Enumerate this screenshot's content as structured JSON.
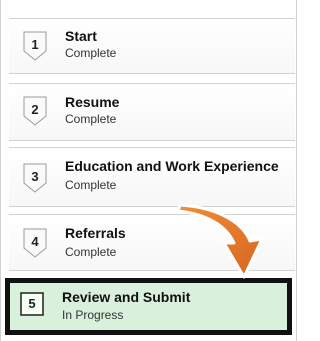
{
  "steps": [
    {
      "number": "1",
      "title": "Start",
      "status": "Complete"
    },
    {
      "number": "2",
      "title": "Resume",
      "status": "Complete"
    },
    {
      "number": "3",
      "title": "Education and Work Experience",
      "status": "Complete"
    },
    {
      "number": "4",
      "title": "Referrals",
      "status": "Complete"
    },
    {
      "number": "5",
      "title": "Review and Submit",
      "status": "In Progress"
    }
  ],
  "colors": {
    "active_background": "#d9f0dc",
    "active_border": "#111111",
    "arrow_fill": "#e8742a"
  },
  "icons": {
    "step_badge": "step-number-chevron-icon",
    "pointer": "curved-arrow-icon"
  }
}
